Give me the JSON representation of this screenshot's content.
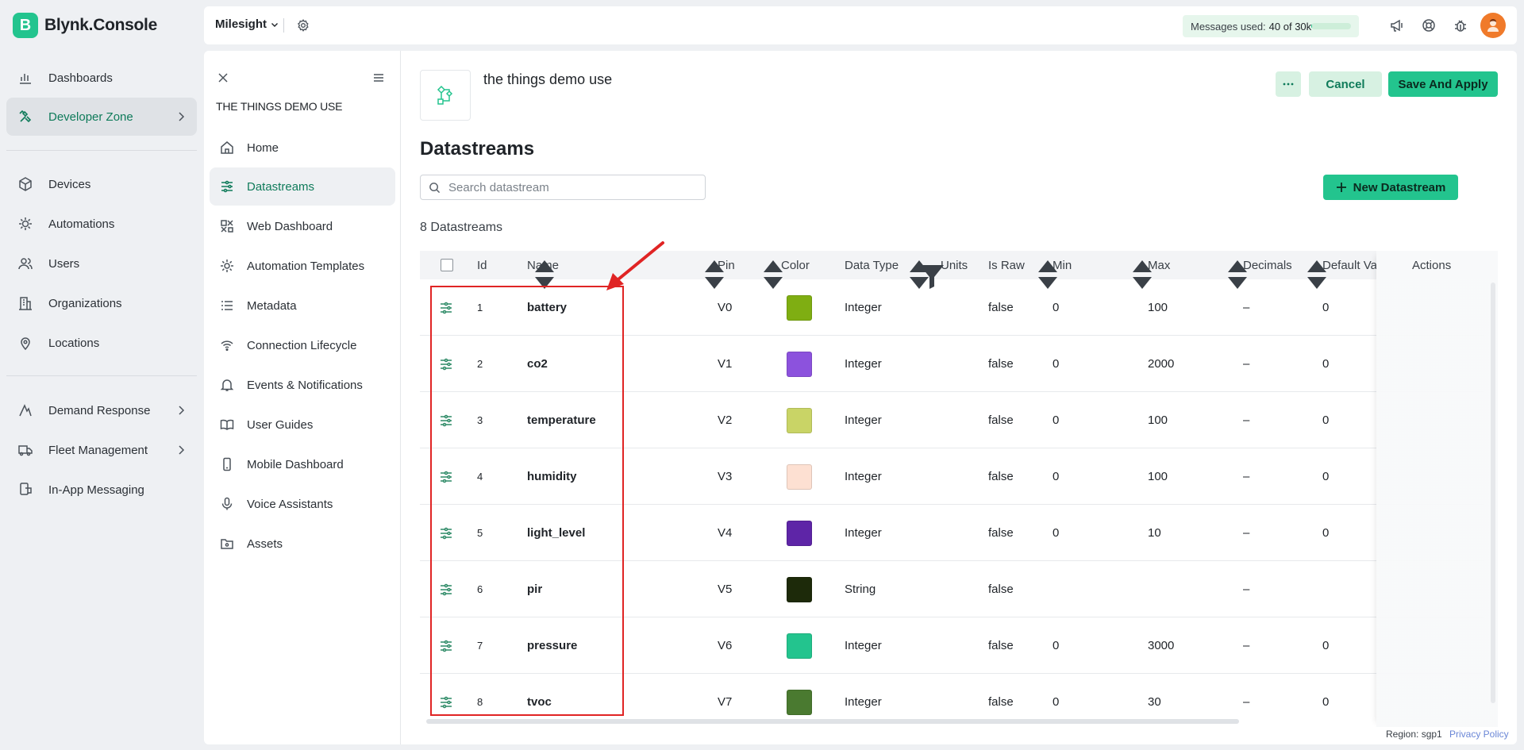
{
  "brand": {
    "logo_letter": "B",
    "name": "Blynk.Console",
    "accent": "#23c48e"
  },
  "nav": {
    "items": [
      {
        "label": "Dashboards",
        "icon": "bar-chart-icon"
      },
      {
        "label": "Developer Zone",
        "icon": "tools-icon",
        "active": true
      },
      {
        "label": "Devices",
        "icon": "cube-icon"
      },
      {
        "label": "Automations",
        "icon": "sun-gear-icon"
      },
      {
        "label": "Users",
        "icon": "users-icon"
      },
      {
        "label": "Organizations",
        "icon": "building-icon"
      },
      {
        "label": "Locations",
        "icon": "pin-icon"
      },
      {
        "label": "Demand Response",
        "icon": "lightning-icon"
      },
      {
        "label": "Fleet Management",
        "icon": "truck-icon"
      },
      {
        "label": "In-App Messaging",
        "icon": "message-icon"
      }
    ]
  },
  "topbar": {
    "org_name": "Milesight",
    "messages_label": "Messages used:",
    "messages_value": "40 of 30k",
    "messages_fraction": 0.0013
  },
  "template": {
    "title_upper": "THE THINGS DEMO USE",
    "name": "the things demo use",
    "cancel_label": "Cancel",
    "save_label": "Save And Apply"
  },
  "submenu": {
    "items": [
      {
        "label": "Home",
        "icon": "home-icon"
      },
      {
        "label": "Datastreams",
        "icon": "datastream-icon",
        "active": true
      },
      {
        "label": "Web Dashboard",
        "icon": "web-dashboard-icon"
      },
      {
        "label": "Automation Templates",
        "icon": "automation-icon"
      },
      {
        "label": "Metadata",
        "icon": "list-icon"
      },
      {
        "label": "Connection Lifecycle",
        "icon": "wifi-icon"
      },
      {
        "label": "Events & Notifications",
        "icon": "bell-icon"
      },
      {
        "label": "User Guides",
        "icon": "book-icon"
      },
      {
        "label": "Mobile Dashboard",
        "icon": "phone-icon"
      },
      {
        "label": "Voice Assistants",
        "icon": "mic-icon"
      },
      {
        "label": "Assets",
        "icon": "folder-icon"
      }
    ]
  },
  "datastreams": {
    "page_title": "Datastreams",
    "search_placeholder": "Search datastream",
    "new_label": "New Datastream",
    "count_label": "8 Datastreams",
    "columns": [
      "Id",
      "Name",
      "Pin",
      "Color",
      "Data Type",
      "Units",
      "Is Raw",
      "Min",
      "Max",
      "Decimals",
      "Default Va",
      "Actions"
    ],
    "rows": [
      {
        "id": "1",
        "name": "battery",
        "pin": "V0",
        "color": "#7fae12",
        "type": "Integer",
        "units": "",
        "raw": "false",
        "min": "0",
        "max": "100",
        "decimals": "–",
        "default": "0"
      },
      {
        "id": "2",
        "name": "co2",
        "pin": "V1",
        "color": "#8c52dd",
        "type": "Integer",
        "units": "",
        "raw": "false",
        "min": "0",
        "max": "2000",
        "decimals": "–",
        "default": "0"
      },
      {
        "id": "3",
        "name": "temperature",
        "pin": "V2",
        "color": "#c9d466",
        "type": "Integer",
        "units": "",
        "raw": "false",
        "min": "0",
        "max": "100",
        "decimals": "–",
        "default": "0"
      },
      {
        "id": "4",
        "name": "humidity",
        "pin": "V3",
        "color": "#fde0d2",
        "type": "Integer",
        "units": "",
        "raw": "false",
        "min": "0",
        "max": "100",
        "decimals": "–",
        "default": "0"
      },
      {
        "id": "5",
        "name": "light_level",
        "pin": "V4",
        "color": "#5e25a7",
        "type": "Integer",
        "units": "",
        "raw": "false",
        "min": "0",
        "max": "10",
        "decimals": "–",
        "default": "0"
      },
      {
        "id": "6",
        "name": "pir",
        "pin": "V5",
        "color": "#1d2a0a",
        "type": "String",
        "units": "",
        "raw": "false",
        "min": "",
        "max": "",
        "decimals": "–",
        "default": ""
      },
      {
        "id": "7",
        "name": "pressure",
        "pin": "V6",
        "color": "#23c48e",
        "type": "Integer",
        "units": "",
        "raw": "false",
        "min": "0",
        "max": "3000",
        "decimals": "–",
        "default": "0"
      },
      {
        "id": "8",
        "name": "tvoc",
        "pin": "V7",
        "color": "#4a7a30",
        "type": "Integer",
        "units": "",
        "raw": "false",
        "min": "0",
        "max": "30",
        "decimals": "–",
        "default": "0"
      }
    ]
  },
  "footer": {
    "region": "Region: sgp1",
    "privacy": "Privacy Policy"
  }
}
